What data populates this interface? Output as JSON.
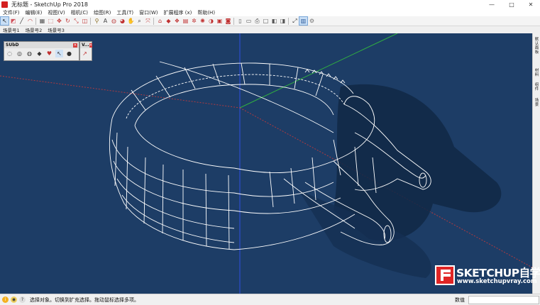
{
  "window": {
    "title": "无标题 - SketchUp Pro 2018",
    "controls": [
      "—",
      "□",
      "✕"
    ]
  },
  "menu": {
    "items": [
      "文件(F)",
      "编辑(E)",
      "视图(V)",
      "相机(C)",
      "绘图(R)",
      "工具(T)",
      "窗口(W)",
      "扩展程序 (x)",
      "帮助(H)"
    ]
  },
  "toolbar": {
    "icons": [
      {
        "name": "select-icon",
        "glyph": "↖",
        "color": "#222"
      },
      {
        "name": "eraser-icon",
        "glyph": "◩",
        "color": "#d0505a"
      },
      {
        "name": "line-icon",
        "glyph": "╱",
        "color": "#333"
      },
      {
        "name": "arc-icon",
        "glyph": "◠",
        "color": "#c04040"
      },
      {
        "name": "shape-icon",
        "glyph": "▦",
        "color": "#555"
      },
      {
        "name": "push-pull-icon",
        "glyph": "⬚",
        "color": "#b04040"
      },
      {
        "name": "move-icon",
        "glyph": "✥",
        "color": "#c03030"
      },
      {
        "name": "rotate-icon",
        "glyph": "↻",
        "color": "#c03030"
      },
      {
        "name": "scale-icon",
        "glyph": "⤡",
        "color": "#c03030"
      },
      {
        "name": "offset-icon",
        "glyph": "◫",
        "color": "#c03030"
      },
      {
        "name": "tape-measure-icon",
        "glyph": "⚲",
        "color": "#8a6d20"
      },
      {
        "name": "text-icon",
        "glyph": "A",
        "color": "#444"
      },
      {
        "name": "paint-bucket-icon",
        "glyph": "◍",
        "color": "#c05050"
      },
      {
        "name": "orbit-icon",
        "glyph": "◕",
        "color": "#c03030"
      },
      {
        "name": "pan-icon",
        "glyph": "✋",
        "color": "#b07030"
      },
      {
        "name": "zoom-icon",
        "glyph": "⌕",
        "color": "#333"
      },
      {
        "name": "zoom-extents-icon",
        "glyph": "⤧",
        "color": "#c03030"
      },
      {
        "name": "warehouse-icon",
        "glyph": "⌂",
        "color": "#c03030"
      },
      {
        "name": "extension-icon",
        "glyph": "◆",
        "color": "#c03030"
      },
      {
        "name": "component-icon",
        "glyph": "❖",
        "color": "#c03030"
      },
      {
        "name": "layout-icon",
        "glyph": "▤",
        "color": "#c03030"
      },
      {
        "name": "gear-red-icon",
        "glyph": "✲",
        "color": "#c03030"
      },
      {
        "name": "sandbox-icon",
        "glyph": "✺",
        "color": "#c03030"
      },
      {
        "name": "solid-icon",
        "glyph": "◑",
        "color": "#c03030"
      },
      {
        "name": "section-icon",
        "glyph": "▣",
        "color": "#c03030"
      },
      {
        "name": "camera-icon",
        "glyph": "◙",
        "color": "#c03030"
      },
      {
        "name": "file-icon",
        "glyph": "▯",
        "color": "#555"
      },
      {
        "name": "folder-icon",
        "glyph": "▭",
        "color": "#555"
      },
      {
        "name": "print-icon",
        "glyph": "⎙",
        "color": "#555"
      },
      {
        "name": "model-info-icon",
        "glyph": "□",
        "color": "#555"
      },
      {
        "name": "layers-icon",
        "glyph": "◧",
        "color": "#555"
      },
      {
        "name": "style-icon",
        "glyph": "◨",
        "color": "#555"
      },
      {
        "name": "perspective-icon",
        "glyph": "⤢",
        "color": "#333"
      },
      {
        "name": "tray-icon",
        "glyph": "▥",
        "color": "#2a5a9a"
      },
      {
        "name": "settings-icon",
        "glyph": "⚙",
        "color": "#777"
      }
    ]
  },
  "scenes": {
    "tabs": [
      "场景号1",
      "场景号2",
      "场景号3"
    ]
  },
  "subd_panel": {
    "title": "SUbD",
    "close": "✕",
    "icons": [
      {
        "name": "subd-toggle-icon",
        "glyph": "◌"
      },
      {
        "name": "subd-smooth-icon",
        "glyph": "◎"
      },
      {
        "name": "subd-crease-icon",
        "glyph": "◍"
      },
      {
        "name": "subd-cube-icon",
        "glyph": "◆"
      },
      {
        "name": "subd-heart-icon",
        "glyph": "♥"
      },
      {
        "name": "subd-cursor-icon",
        "glyph": "↖"
      },
      {
        "name": "subd-head-icon",
        "glyph": "●"
      }
    ]
  },
  "v_panel": {
    "title": "V...",
    "close": "✕",
    "icon": "↗"
  },
  "right_tray": {
    "tabs": [
      "默认面板",
      "材料",
      "组件",
      "场景"
    ]
  },
  "watermark": {
    "brand": "SKETCHUP自学",
    "url": "www.sketchupvray.com"
  },
  "status": {
    "text": "选择对象。切换到扩充选择。拖动鼠标选择多项。",
    "measure_label": "数值",
    "measure_value": ""
  },
  "colors": {
    "viewport_bg": "#1d3d66",
    "model_line": "#ffffff",
    "shadow": "#112845",
    "axis_red": "#cc3030",
    "axis_green": "#30b040",
    "axis_blue": "#3050e0"
  }
}
